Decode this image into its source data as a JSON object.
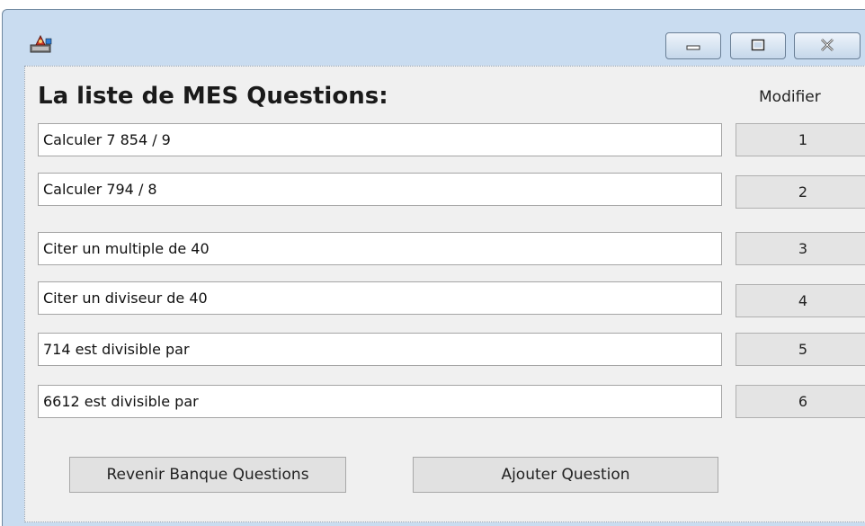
{
  "window": {
    "icon": "app-icon",
    "controls": {
      "minimize": "minimize-icon",
      "maximize": "maximize-icon",
      "close": "close-icon"
    }
  },
  "main": {
    "heading": "La liste de MES Questions:",
    "modify_label": "Modifier",
    "questions": [
      {
        "text": "Calculer 7 854 / 9",
        "button": "1"
      },
      {
        "text": "Calculer 794 / 8",
        "button": "2"
      },
      {
        "text": "Citer un multiple de 40",
        "button": "3"
      },
      {
        "text": "Citer un diviseur de 40",
        "button": "4"
      },
      {
        "text": "714 est divisible par",
        "button": "5"
      },
      {
        "text": "6612 est divisible par",
        "button": "6"
      }
    ],
    "back_button": "Revenir Banque Questions",
    "add_button": "Ajouter Question"
  }
}
